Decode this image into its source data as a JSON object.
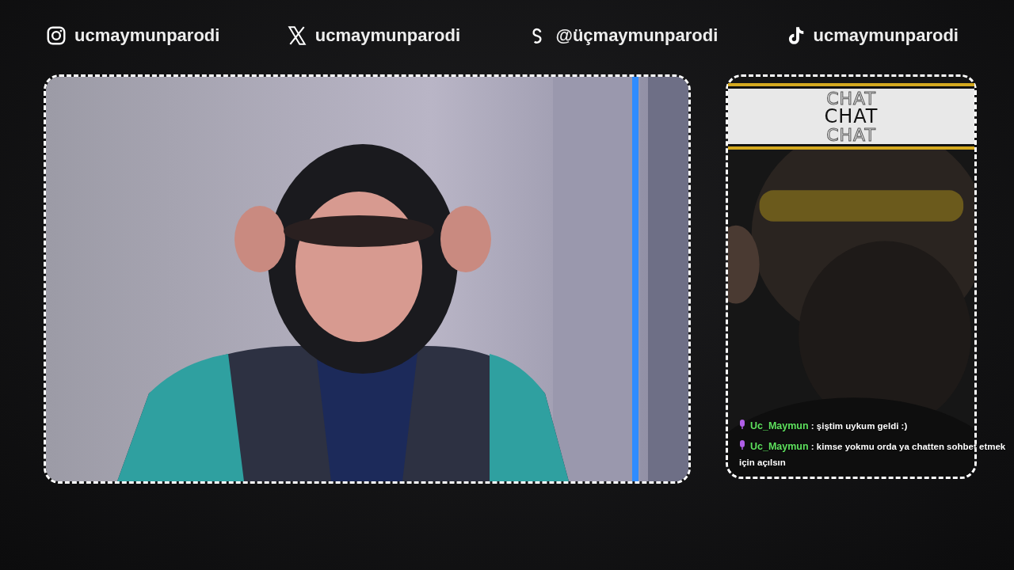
{
  "socials": [
    {
      "kind": "instagram",
      "handle": "ucmaymunparodi"
    },
    {
      "kind": "x",
      "handle": "ucmaymunparodi"
    },
    {
      "kind": "threads",
      "handle": "@üçmaymunparodi"
    },
    {
      "kind": "tiktok",
      "handle": "ucmaymunparodi"
    }
  ],
  "chat": {
    "header": [
      "CHAT",
      "CHAT",
      "CHAT"
    ],
    "messages": [
      {
        "user": "Uc_Maymun",
        "separator": ":",
        "text": "şiştim uykum geldi :)"
      },
      {
        "user": "Uc_Maymun",
        "separator": ":",
        "text": "kimse yokmu orda ya chatten sohbet etmek için açılsın"
      }
    ]
  }
}
